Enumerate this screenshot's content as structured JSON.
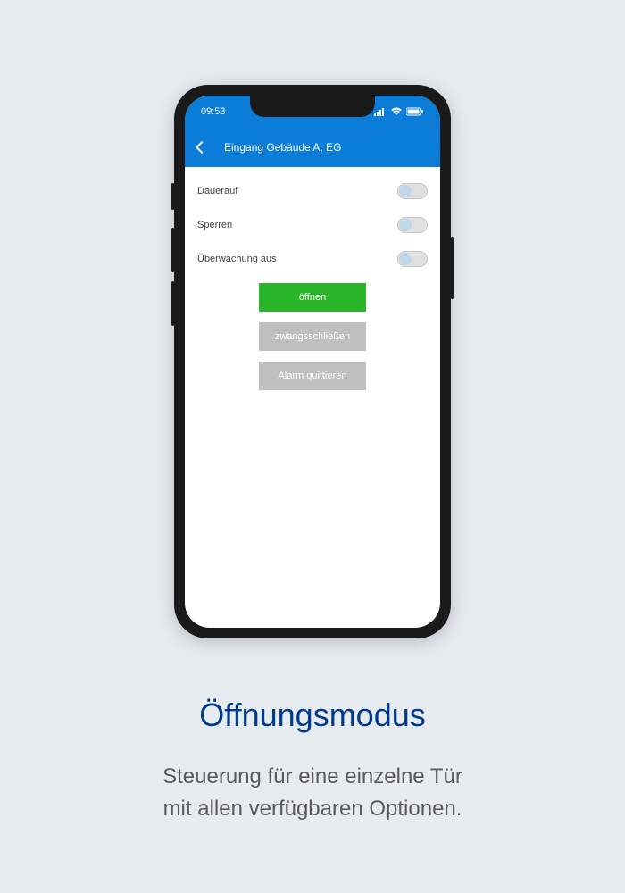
{
  "statusBar": {
    "time": "09:53"
  },
  "header": {
    "title": "Eingang Gebäude A, EG"
  },
  "settings": {
    "item1": "Dauerauf",
    "item2": "Sperren",
    "item3": "Überwachung aus"
  },
  "buttons": {
    "open": "öffnen",
    "forceClose": "zwangsschließen",
    "ackAlarm": "Alarm quittieren"
  },
  "caption": {
    "title": "Öffnungsmodus",
    "line1": "Steuerung für eine einzelne Tür",
    "line2": "mit allen verfügbaren Optionen."
  }
}
